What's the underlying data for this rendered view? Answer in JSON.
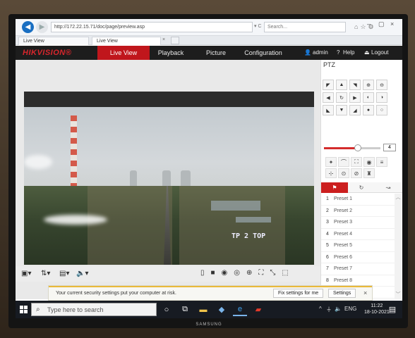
{
  "browser": {
    "url": "http://172.22.15.71/doc/page/preview.asp",
    "url_controls": "▾ C",
    "search_placeholder": "Search...",
    "tabs": [
      {
        "label": "Live View"
      },
      {
        "label": "Live View"
      }
    ],
    "tab_close": "×",
    "window_controls": {
      "minimize": "–",
      "maximize": "▢",
      "close": "×"
    }
  },
  "app": {
    "logo": "HIKVISION®",
    "nav": [
      "Live View",
      "Playback",
      "Picture",
      "Configuration"
    ],
    "active_nav": "Live View",
    "user": "admin",
    "help": "Help",
    "logout": "Logout"
  },
  "video": {
    "osd_text": "TP 2 TOP"
  },
  "ptz": {
    "title": "PTZ",
    "speed_value": "4",
    "speed_fraction": 0.6,
    "presets": [
      "Preset 1",
      "Preset 2",
      "Preset 3",
      "Preset 4",
      "Preset 5",
      "Preset 6",
      "Preset 7",
      "Preset 8",
      "Preset 9"
    ],
    "preset_numbers": [
      "1",
      "2",
      "3",
      "4",
      "5",
      "6",
      "7",
      "8",
      "9"
    ],
    "colors": {
      "accent": "#c0161c"
    }
  },
  "security_bar": {
    "message": "Your current security settings put your computer at risk.",
    "fix_button": "Fix settings for me",
    "settings_button": "Settings",
    "close": "×"
  },
  "taskbar": {
    "search_placeholder": "Type here to search",
    "lang": "ENG",
    "time": "11:22",
    "date": "18-10-2021"
  },
  "monitor": {
    "brand": "SAMSUNG"
  }
}
